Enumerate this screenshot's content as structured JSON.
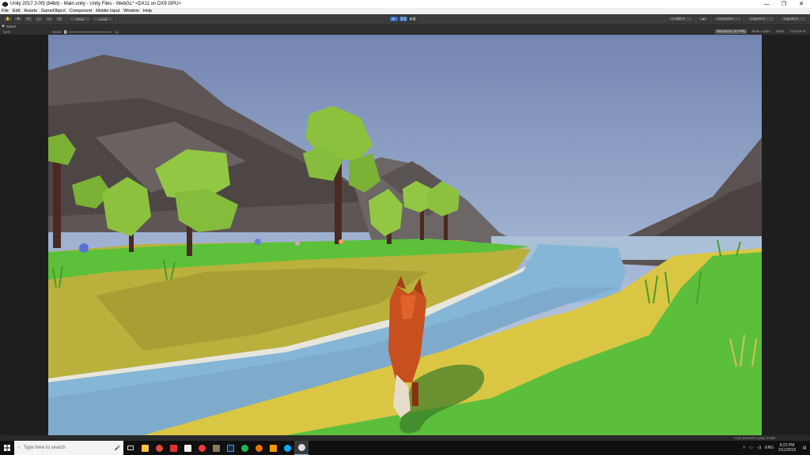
{
  "window": {
    "title": "Unity 2017.3.0f3 (64bit) - Main.unity - Unity Files - WebGL* <DX11 on DX9 GPU>",
    "minimize": "—",
    "maximize": "❐",
    "close": "✕"
  },
  "menu": [
    "File",
    "Edit",
    "Assets",
    "GameObject",
    "Component",
    "Mobile Input",
    "Window",
    "Help"
  ],
  "toolbar": {
    "pivot": "Pivot",
    "space": "Local",
    "collab": "Collab ▾",
    "account": "Account ▾",
    "layers": "Layers ▾",
    "layout": "Layout ▾"
  },
  "game_view": {
    "tab_label": "Game",
    "display": "16:9",
    "scale_label": "Scale",
    "scale_value": "1x",
    "options": [
      "Maximize On Play",
      "Mute Audio",
      "Stats",
      "Gizmos ▾"
    ]
  },
  "status": {
    "text": "Auto paused in play mode"
  },
  "taskbar": {
    "search_placeholder": "Type here to search",
    "time": "8:22 PM",
    "date": "2/11/2018",
    "language": "ENG"
  },
  "colors": {
    "sky": "#8aa0c6",
    "grass": "#5cbf3b",
    "water": "#86b5d4",
    "sand": "#d8c644",
    "fox": "#c8501e",
    "mountain": "#5a5452",
    "play_active": "#3d6fc4"
  }
}
